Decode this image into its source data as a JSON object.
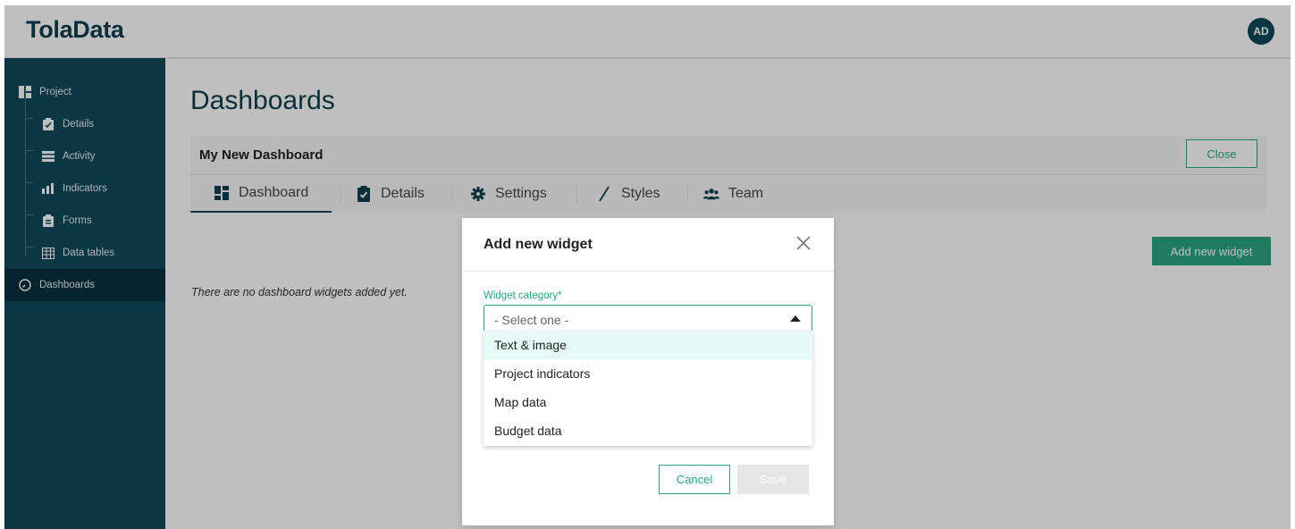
{
  "app": {
    "logo": "TolaData",
    "avatar_initials": "AD"
  },
  "sidebar": {
    "project_label": "Project",
    "items": [
      {
        "label": "Details",
        "icon": "clipboard-check-icon"
      },
      {
        "label": "Activity",
        "icon": "list-icon"
      },
      {
        "label": "Indicators",
        "icon": "bar-chart-icon"
      },
      {
        "label": "Forms",
        "icon": "clipboard-icon"
      },
      {
        "label": "Data tables",
        "icon": "table-icon"
      }
    ],
    "dashboards_label": "Dashboards"
  },
  "main": {
    "title": "Dashboards",
    "dashboard_name": "My New Dashboard",
    "close_label": "Close",
    "tabs": [
      {
        "label": "Dashboard",
        "icon": "dashboard-icon",
        "active": true
      },
      {
        "label": "Details",
        "icon": "clipboard-check-icon",
        "active": false
      },
      {
        "label": "Settings",
        "icon": "gear-icon",
        "active": false
      },
      {
        "label": "Styles",
        "icon": "pen-icon",
        "active": false
      },
      {
        "label": "Team",
        "icon": "team-icon",
        "active": false
      }
    ],
    "empty_message": "There are no dashboard widgets added yet.",
    "add_widget_label": "Add new widget"
  },
  "modal": {
    "title": "Add new widget",
    "field_label": "Widget category*",
    "select_value": "- Select one -",
    "options": [
      "Text & image",
      "Project indicators",
      "Map data",
      "Budget data"
    ],
    "highlighted_option": "Text & image",
    "cancel_label": "Cancel",
    "save_label": "Save"
  },
  "colors": {
    "brand_dark": "#0e4a5a",
    "accent_green": "#2aa67f",
    "highlight": "#e6fbf5"
  }
}
